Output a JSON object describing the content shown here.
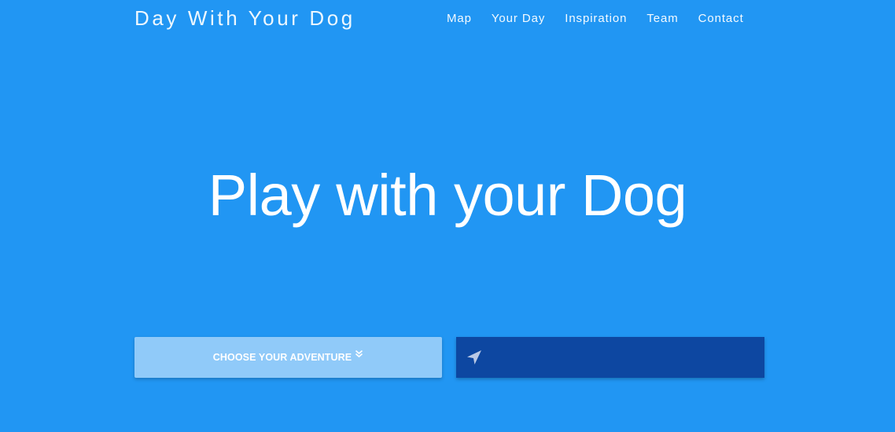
{
  "header": {
    "brand": "Day With Your Dog",
    "nav": [
      {
        "label": "Map"
      },
      {
        "label": "Your Day"
      },
      {
        "label": "Inspiration"
      },
      {
        "label": "Team"
      },
      {
        "label": "Contact"
      }
    ]
  },
  "hero": {
    "title_strong": "Play",
    "title_light": "with your Dog"
  },
  "actions": {
    "adventure_label": "CHOOSE YOUR ADVENTURE",
    "adventure_icon": "double-chevron-down-icon",
    "location_icon": "navigation-arrow-icon",
    "location_value": "",
    "location_placeholder": ""
  },
  "colors": {
    "background": "#2196f3",
    "adventure_button": "#90caf9",
    "location_box": "#0d47a1",
    "text": "#ffffff"
  }
}
